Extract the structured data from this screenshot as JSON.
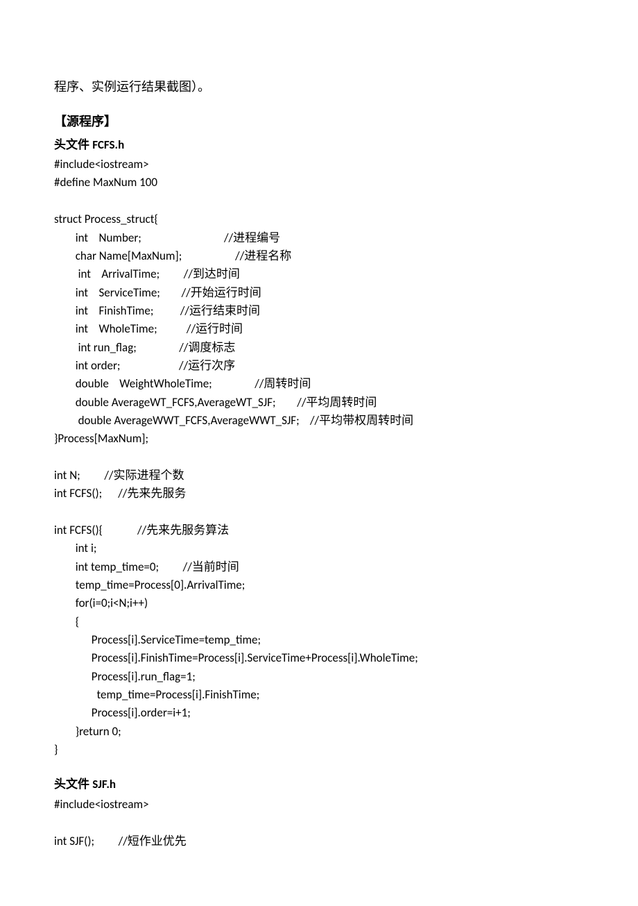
{
  "intro": "程序、实例运行结果截图）。",
  "heading_main": "【源程序】",
  "section1": {
    "heading_cn": "头文件 ",
    "heading_en": "FCFS.h",
    "code": "#include<iostream>\n#define MaxNum 100\n\nstruct Process_struct{\n        int    Number;                               //进程编号\n        char Name[MaxNum];                    //进程名称\n         int    ArrivalTime;         //到达时间\n        int    ServiceTime;        //开始运行时间\n        int    FinishTime;          //运行结束时间\n        int    WholeTime;           //运行时间\n         int run_flag;                //调度标志\n        int order;                      //运行次序\n        double    WeightWholeTime;                //周转时间\n        double AverageWT_FCFS,AverageWT_SJF;        //平均周转时间\n         double AverageWWT_FCFS,AverageWWT_SJF;    //平均带权周转时间\n}Process[MaxNum];\n\nint N;         //实际进程个数\nint FCFS();      //先来先服务\n\nint FCFS(){             //先来先服务算法\n        int i;\n        int temp_time=0;         //当前时间\n        temp_time=Process[0].ArrivalTime;\n        for(i=0;i<N;i++)\n        {\n              Process[i].ServiceTime=temp_time;\n              Process[i].FinishTime=Process[i].ServiceTime+Process[i].WholeTime;\n              Process[i].run_flag=1;\n                temp_time=Process[i].FinishTime;\n              Process[i].order=i+1;\n        }return 0;\n}"
  },
  "section2": {
    "heading_cn": "头文件 ",
    "heading_en": "SJF.h",
    "code": "#include<iostream>\n\nint SJF();         //短作业优先"
  }
}
